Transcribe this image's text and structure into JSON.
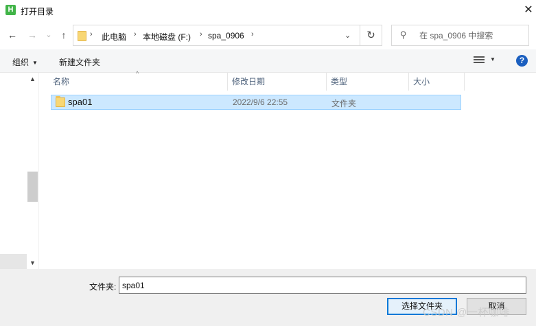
{
  "window": {
    "title": "打开目录",
    "app_icon_letter": "H",
    "close_glyph": "✕"
  },
  "nav": {
    "back_glyph": "←",
    "forward_glyph": "→",
    "recent_glyph": "⌄",
    "up_glyph": "↑",
    "breadcrumbs": [
      "此电脑",
      "本地磁盘 (F:)",
      "spa_0906"
    ],
    "separator": "›",
    "refresh_glyph": "↻",
    "search_placeholder": "在 spa_0906 中搜索"
  },
  "toolbar": {
    "organize_label": "组织",
    "new_folder_label": "新建文件夹",
    "help_glyph": "?"
  },
  "columns": {
    "name": "名称",
    "date": "修改日期",
    "type": "类型",
    "size": "大小"
  },
  "files": [
    {
      "name": "spa01",
      "modified": "2022/9/6 22:55",
      "type": "文件夹",
      "size": ""
    }
  ],
  "footer": {
    "folder_label": "文件夹:",
    "folder_value": "spa01",
    "select_button": "选择文件夹",
    "cancel_button": "取消"
  },
  "watermark": "CSDN @一杯咖啡",
  "colors": {
    "selection_bg": "#cce8ff",
    "selection_border": "#99d1ff",
    "primary_border": "#0078d7",
    "help_icon": "#1b5fbf"
  }
}
